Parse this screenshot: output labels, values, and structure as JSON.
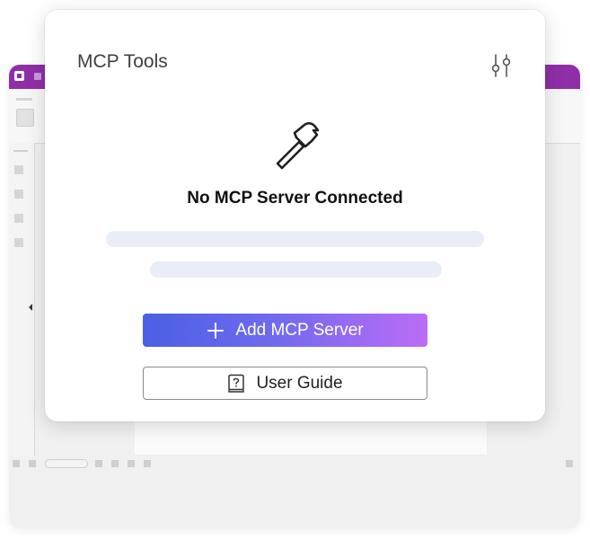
{
  "panel": {
    "title": "MCP Tools",
    "empty_state_title": "No MCP Server Connected",
    "add_button_label": "Add MCP Server",
    "guide_button_label": "User Guide"
  },
  "colors": {
    "accent_start": "#4a5fe4",
    "accent_end": "#bb6cf6",
    "titlebar": "#8f2fa8",
    "skeleton": "#e9edf8"
  },
  "icons": {
    "settings": "sliders-icon",
    "empty_state": "hammer-icon",
    "add": "plus-icon",
    "guide": "help-book-icon"
  }
}
